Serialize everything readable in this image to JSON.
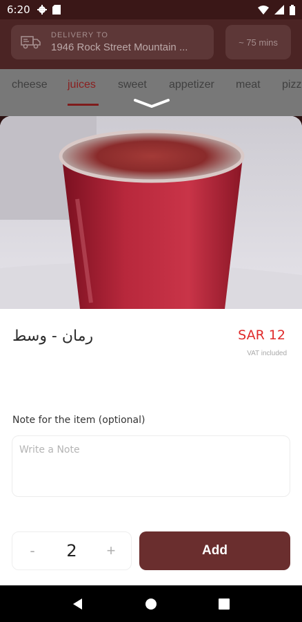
{
  "status_bar": {
    "time": "6:20",
    "left_icons": [
      "gear-icon",
      "sim-card-icon"
    ],
    "right_icons": [
      "wifi-icon",
      "signal-icon",
      "battery-icon"
    ]
  },
  "header": {
    "delivery_label": "DELIVERY TO",
    "delivery_address": "1946 Rock Street Mountain ...",
    "eta": "~ 75 mins"
  },
  "tabs": [
    {
      "label": "cheese",
      "active": false
    },
    {
      "label": "juices",
      "active": true
    },
    {
      "label": "sweet",
      "active": false
    },
    {
      "label": "appetizer",
      "active": false
    },
    {
      "label": "meat",
      "active": false
    },
    {
      "label": "pizza",
      "active": false
    }
  ],
  "product": {
    "name": "رمان - وسط",
    "price": "SAR 12",
    "vat_note": "VAT included",
    "image_icon": "pomegranate-juice-cup-photo"
  },
  "note": {
    "label": "Note for the item (optional)",
    "placeholder": "Write a Note",
    "value": ""
  },
  "quantity": {
    "minus": "-",
    "value": "2",
    "plus": "+"
  },
  "add_button": {
    "label": "Add"
  },
  "colors": {
    "brand": "#6a2e2e",
    "price": "#e02a2a",
    "active_tab": "#8a1e1e"
  }
}
